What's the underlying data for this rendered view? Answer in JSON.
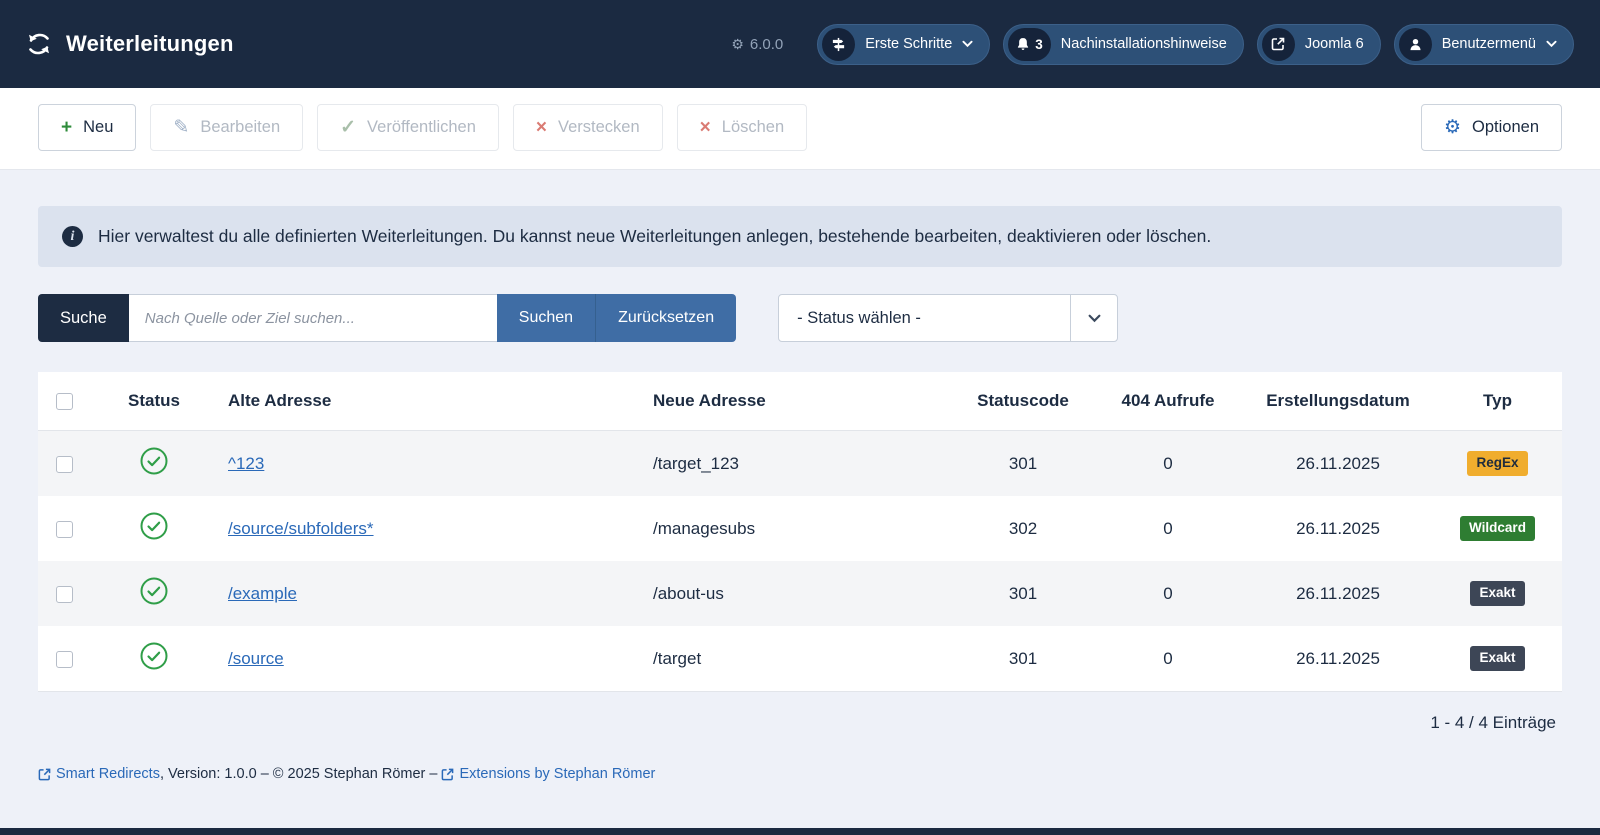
{
  "colors": {
    "header_bg": "#1b2a41",
    "pill_bg": "#2d5077",
    "accent_blue": "#3f6da5",
    "link_blue": "#2a69b8",
    "status_green": "#2f9e48",
    "badge_regex_bg": "#f0ad2e",
    "badge_wildcard_bg": "#2e7d32",
    "badge_exakt_bg": "#3d4656",
    "alert_bg": "#dbe2ee",
    "page_bg": "#eef1f8"
  },
  "header": {
    "title": "Weiterleitungen",
    "version": "6.0.0",
    "pill_erste_schritte": "Erste Schritte",
    "notif_count": "3",
    "pill_notifications": "Nachinstallationshinweise",
    "pill_joomla": "Joomla 6",
    "pill_user": "Benutzermenü"
  },
  "toolbar": {
    "new": "Neu",
    "edit": "Bearbeiten",
    "publish": "Veröffentlichen",
    "hide": "Verstecken",
    "delete": "Löschen",
    "options": "Optionen"
  },
  "glyphs": {
    "plus": "+",
    "pencil": "✎",
    "check": "✓",
    "cross": "×",
    "gear": "⚙",
    "info": "i"
  },
  "alert": {
    "text": "Hier verwaltest du alle definierten Weiterleitungen. Du kannst neue Weiterleitungen anlegen, bestehende bearbeiten, deaktivieren oder löschen."
  },
  "search": {
    "label": "Suche",
    "placeholder": "Nach Quelle oder Ziel suchen...",
    "submit": "Suchen",
    "reset": "Zurücksetzen",
    "status_select": "- Status wählen -"
  },
  "table": {
    "headers": {
      "status": "Status",
      "old": "Alte Adresse",
      "new": "Neue Adresse",
      "code": "Statuscode",
      "hits": "404 Aufrufe",
      "date": "Erstellungsdatum",
      "type": "Typ"
    },
    "rows": [
      {
        "old": "^123",
        "new": "/target_123",
        "code": "301",
        "hits": "0",
        "date": "26.11.2025",
        "type": "RegEx"
      },
      {
        "old": "/source/subfolders*",
        "new": "/managesubs",
        "code": "302",
        "hits": "0",
        "date": "26.11.2025",
        "type": "Wildcard"
      },
      {
        "old": "/example",
        "new": "/about-us",
        "code": "301",
        "hits": "0",
        "date": "26.11.2025",
        "type": "Exakt"
      },
      {
        "old": "/source",
        "new": "/target",
        "code": "301",
        "hits": "0",
        "date": "26.11.2025",
        "type": "Exakt"
      }
    ],
    "pagination": "1 - 4 / 4 Einträge"
  },
  "footer": {
    "link_product": "Smart Redirects",
    "middle": ", Version: 1.0.0 – © 2025 Stephan Römer – ",
    "link_author": "Extensions by Stephan Römer"
  }
}
